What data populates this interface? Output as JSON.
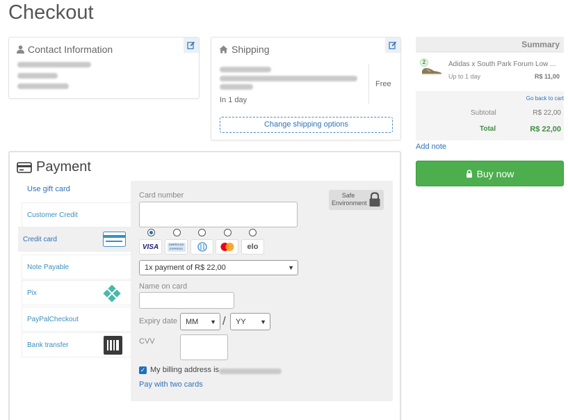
{
  "page": {
    "title": "Checkout"
  },
  "contact": {
    "title": "Contact Information"
  },
  "shipping": {
    "title": "Shipping",
    "price": "Free",
    "days": "In 1 day",
    "change_label": "Change shipping options"
  },
  "summary": {
    "title": "Summary",
    "item": {
      "qty": "2",
      "name": "Adidas x South Park Forum Low ...",
      "delivery": "Up to 1 day",
      "price": "R$ 11,00"
    },
    "go_back": "Go back to cart",
    "subtotal_label": "Subtotal",
    "subtotal_value": "R$ 22,00",
    "total_label": "Total",
    "total_value": "R$ 22,00"
  },
  "add_note": "Add note",
  "buy_now": "Buy now",
  "payment": {
    "title": "Payment",
    "gift_card": "Use gift card",
    "methods": [
      {
        "label": "Customer Credit"
      },
      {
        "label": "Credit card"
      },
      {
        "label": "Note Payable"
      },
      {
        "label": "Pix"
      },
      {
        "label": "PayPalCheckout"
      },
      {
        "label": "Bank transfer"
      }
    ],
    "card_number_label": "Card number",
    "safe_environment": "Safe Environment",
    "brands": [
      "VISA",
      "AMERICAN EXPRESS",
      "Diners",
      "Mastercard",
      "elo"
    ],
    "installments": "1x payment of R$ 22,00",
    "name_label": "Name on card",
    "expiry_label": "Expiry date",
    "month_placeholder": "MM",
    "year_placeholder": "YY",
    "cvv_label": "CVV",
    "billing_text": "My billing address is",
    "two_cards": "Pay with two cards"
  },
  "colors": {
    "accent": "#2f72b8",
    "success": "#4cae4c"
  }
}
